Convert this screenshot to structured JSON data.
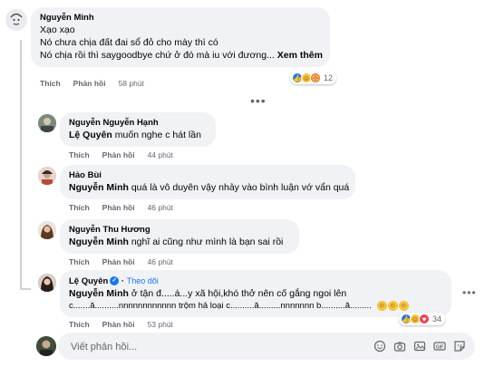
{
  "top_comment": {
    "author": "Nguyễn Minh",
    "lines": [
      "Xạo xạo",
      "Nó chưa chịa đất đai sổ đỏ cho mày thì có",
      "Nó chịa rồi thì saygoodbye chứ ở đó mà iu với đương..."
    ],
    "see_more": "Xem thêm",
    "like_label": "Thích",
    "reply_label": "Phản hồi",
    "time": "58 phút",
    "reaction_count": "12"
  },
  "replies": [
    {
      "author": "Nguyễn Nguyễn Hạnh",
      "mention": "Lệ Quyên",
      "text": " muốn nghe c hát lần",
      "like_label": "Thích",
      "reply_label": "Phản hồi",
      "time": "44 phút"
    },
    {
      "author": "Hảo Bùi",
      "mention": "Nguyễn Minh",
      "text": " quá là vô duyên vậy nhảy vào bình luận vớ vẩn quá",
      "like_label": "Thích",
      "reply_label": "Phản hồi",
      "time": "46 phút"
    },
    {
      "author": "Nguyễn Thu Hương",
      "mention": "Nguyễn Minh",
      "text": " nghĩ ai cũng như mình là bạn sai rồi",
      "like_label": "Thích",
      "reply_label": "Phản hồi",
      "time": "46 phút"
    },
    {
      "author": "Lệ Quyên",
      "follow": "Theo dõi",
      "mention": "Nguyễn Minh",
      "text": " ở tận đ.....á...y xã hội,khó thở nên cố gắng ngoi lên",
      "line2": "c.......ă..........nnnnnnnnnnnn trộm hả loại c..........ă.........nnnnnnn b..........ă.........",
      "like_label": "Thích",
      "reply_label": "Phản hồi",
      "time": "53 phút",
      "reaction_count": "34"
    }
  ],
  "composer": {
    "placeholder": "Viết phản hồi..."
  },
  "colors": {
    "bubble": "#f0f2f5",
    "like_blue": "#1877f2",
    "love_red": "#f33e58",
    "haha_yellow": "#f7c33b",
    "secondary_text": "#65676b"
  },
  "icons": {
    "composer_tools": [
      "emoji-icon",
      "camera-icon",
      "photo-icon",
      "gif-icon",
      "sticker-icon"
    ]
  }
}
